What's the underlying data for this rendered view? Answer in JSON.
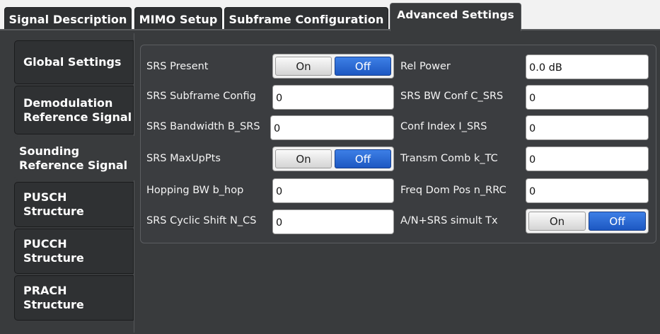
{
  "tabs": [
    {
      "label": "Signal Description"
    },
    {
      "label": "MIMO Setup"
    },
    {
      "label": "Subframe Configuration"
    },
    {
      "label": "Advanced Settings"
    }
  ],
  "sidebar": {
    "items": [
      {
        "label": "Global Settings"
      },
      {
        "label": "Demodulation\nReference Signal"
      },
      {
        "label": "Sounding\nReference Signal"
      },
      {
        "label": "PUSCH\nStructure"
      },
      {
        "label": "PUCCH\nStructure"
      },
      {
        "label": "PRACH\nStructure"
      }
    ]
  },
  "settings": {
    "srs_present": {
      "label": "SRS Present",
      "on": "On",
      "off": "Off",
      "selected": "Off"
    },
    "rel_power": {
      "label": "Rel Power",
      "value": "0.0 dB"
    },
    "srs_subframe_config": {
      "label": "SRS Subframe Config",
      "value": "0"
    },
    "srs_bw_conf": {
      "label": "SRS BW Conf C_SRS",
      "value": "0"
    },
    "srs_bandwidth": {
      "label": "SRS Bandwidth B_SRS",
      "value": "0"
    },
    "conf_index": {
      "label": "Conf Index I_SRS",
      "value": "0"
    },
    "srs_maxuppts": {
      "label": "SRS MaxUpPts",
      "on": "On",
      "off": "Off",
      "selected": "Off"
    },
    "transm_comb": {
      "label": "Transm Comb k_TC",
      "value": "0"
    },
    "hopping_bw": {
      "label": "Hopping BW b_hop",
      "value": "0"
    },
    "freq_dom_pos": {
      "label": "Freq Dom Pos n_RRC",
      "value": "0"
    },
    "srs_cyclic_shift": {
      "label": "SRS Cyclic Shift N_CS",
      "value": "0"
    },
    "an_srs_simult": {
      "label": "A/N+SRS simult Tx",
      "on": "On",
      "off": "Off",
      "selected": "Off"
    }
  },
  "colors": {
    "panel_bg": "#393b3d",
    "tab_bg": "#2f3133",
    "selected_blue": "#1d58c2"
  }
}
